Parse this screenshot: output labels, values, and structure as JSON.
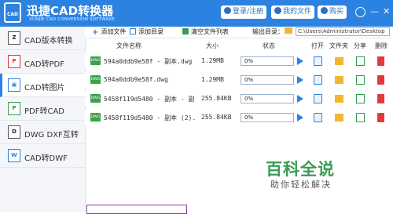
{
  "header": {
    "logo_text": "CAD",
    "title": "迅捷CAD转换器",
    "subtitle": "XUNJIE CAD CONVERSION SOFTWARE",
    "login_label": "登录/注册",
    "myfiles_label": "我的文件",
    "buy_label": "购买",
    "minimize_glyph": "—",
    "close_glyph": "✕",
    "accent": "#2c82e0"
  },
  "sidebar": {
    "items": [
      {
        "label": "CAD版本转换",
        "icon": "cad-version-icon"
      },
      {
        "label": "CAD转PDF",
        "icon": "cad-pdf-icon"
      },
      {
        "label": "CAD转图片",
        "icon": "cad-image-icon",
        "active": true
      },
      {
        "label": "PDF转CAD",
        "icon": "pdf-cad-icon"
      },
      {
        "label": "DWG DXF互转",
        "icon": "dwg-dxf-icon"
      },
      {
        "label": "CAD转DWF",
        "icon": "cad-dwf-icon"
      }
    ]
  },
  "toolbar": {
    "add_file": "添加文件",
    "add_dir": "添加目录",
    "clear_list": "清空文件列表",
    "output_dir_label": "输出目录：",
    "output_path": "C:\\Users\\Administrator\\Desktop"
  },
  "table": {
    "headers": {
      "name": "文件名称",
      "size": "大小",
      "status": "状态",
      "open": "打开",
      "folder": "文件夹",
      "share": "分享",
      "delete": "删除"
    },
    "rows": [
      {
        "type": "DWG",
        "name": "594a0ddb9e58f - 副本.dwg",
        "size": "1.29MB",
        "progress": "0%"
      },
      {
        "type": "DWG",
        "name": "594a0ddb9e58f.dwg",
        "size": "1.29MB",
        "progress": "0%"
      },
      {
        "type": "DWG",
        "name": "5458f119d5480 - 副本 - 副",
        "size": "255.84KB",
        "progress": "0%"
      },
      {
        "type": "DWG",
        "name": "5458f119d5480 - 副本 (2).",
        "size": "255.84KB",
        "progress": "0%"
      }
    ]
  },
  "watermark": {
    "title": "百科全说",
    "subtitle": "助你轻松解决"
  }
}
